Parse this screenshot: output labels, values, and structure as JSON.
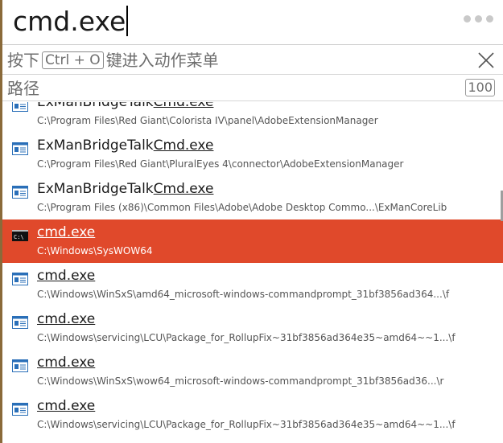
{
  "search": {
    "query": "cmd.exe"
  },
  "hint": {
    "prefix": "按下",
    "key": "Ctrl + O",
    "suffix": "键进入动作菜单"
  },
  "path_bar": {
    "label": "路径",
    "count": "100"
  },
  "colors": {
    "selected_bg": "#e0492b"
  },
  "results": [
    {
      "name_prefix": "ExManBridgeTalk",
      "name_match": "Cmd.exe",
      "path": "C:\\Program Files\\Red Giant\\Colorista IV\\panel\\AdobeExtensionManager",
      "icon": "window-app-icon"
    },
    {
      "name_prefix": "ExManBridgeTalk",
      "name_match": "Cmd.exe",
      "path": "C:\\Program Files\\Red Giant\\PluralEyes 4\\connector\\AdobeExtensionManager",
      "icon": "window-app-icon"
    },
    {
      "name_prefix": "ExManBridgeTalk",
      "name_match": "Cmd.exe",
      "path": "C:\\Program Files (x86)\\Common Files\\Adobe\\Adobe Desktop Commo...\\ExManCoreLib",
      "icon": "window-app-icon"
    },
    {
      "name_prefix": "",
      "name_match": "cmd.exe",
      "path": "C:\\Windows\\SysWOW64",
      "icon": "console-icon",
      "selected": true
    },
    {
      "name_prefix": "",
      "name_match": "cmd.exe",
      "path": "C:\\Windows\\WinSxS\\amd64_microsoft-windows-commandprompt_31bf3856ad364...\\f",
      "icon": "window-app-icon"
    },
    {
      "name_prefix": "",
      "name_match": "cmd.exe",
      "path": "C:\\Windows\\servicing\\LCU\\Package_for_RollupFix~31bf3856ad364e35~amd64~~1...\\f",
      "icon": "window-app-icon"
    },
    {
      "name_prefix": "",
      "name_match": "cmd.exe",
      "path": "C:\\Windows\\WinSxS\\wow64_microsoft-windows-commandprompt_31bf3856ad36...\\r",
      "icon": "window-app-icon"
    },
    {
      "name_prefix": "",
      "name_match": "cmd.exe",
      "path": "C:\\Windows\\servicing\\LCU\\Package_for_RollupFix~31bf3856ad364e35~amd64~~1...\\f",
      "icon": "window-app-icon"
    }
  ]
}
